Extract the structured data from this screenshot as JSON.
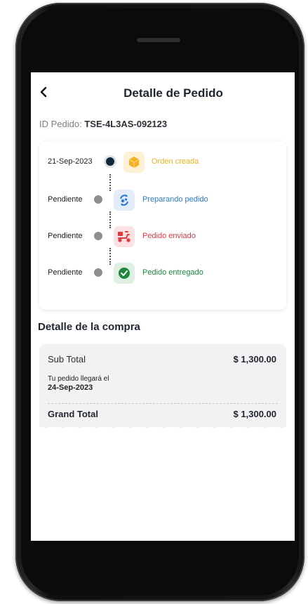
{
  "header": {
    "title": "Detalle de Pedido"
  },
  "order": {
    "id_label": "ID Pedido:",
    "id_value": "TSE-4L3AS-092123"
  },
  "timeline": [
    {
      "date": "21-Sep-2023",
      "status": "Orden creada",
      "icon": "box-icon",
      "color": "#f4b020",
      "bg": "#fdf0d3",
      "active": true
    },
    {
      "date": "Pendiente",
      "status": "Preparando pedido",
      "icon": "recycle-icon",
      "color": "#2a78d6",
      "bg": "#e3ecf9",
      "active": false
    },
    {
      "date": "Pendiente",
      "status": "Pedido enviado",
      "icon": "scooter-icon",
      "color": "#e2393e",
      "bg": "#fbe1e2",
      "active": false
    },
    {
      "date": "Pendiente",
      "status": "Pedido entregado",
      "icon": "check-circle-icon",
      "color": "#1d8a3b",
      "bg": "#dff0e3",
      "active": false
    }
  ],
  "purchase": {
    "title": "Detalle de la compra",
    "subtotal_label": "Sub Total",
    "subtotal_value": "$ 1,300.00",
    "arrival_label": "Tu pedido llegará el",
    "arrival_date": "24-Sep-2023",
    "grand_total_label": "Grand Total",
    "grand_total_value": "$ 1,300.00"
  }
}
